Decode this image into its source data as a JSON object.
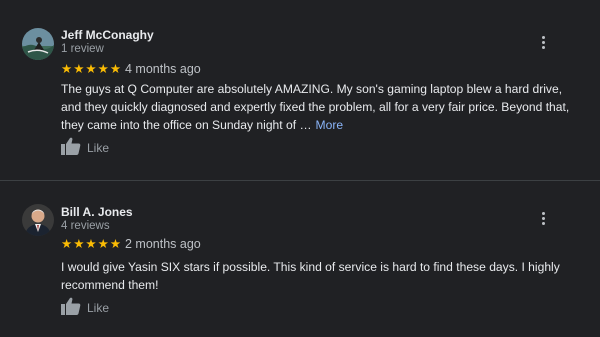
{
  "reviews": [
    {
      "reviewer_name": "Jeff McConaghy",
      "review_count": "1 review",
      "stars": "★★★★★",
      "rating": 5,
      "date": "4 months ago",
      "text": "The guys at Q Computer are absolutely AMAZING. My son's gaming laptop blew a hard drive, and they quickly diagnosed and expertly fixed the problem, all for a very fair price. Beyond that, they came into the office on Sunday night of …",
      "more_label": "More",
      "like_label": "Like"
    },
    {
      "reviewer_name": "Bill A. Jones",
      "review_count": "4 reviews",
      "stars": "★★★★★",
      "rating": 5,
      "date": "2 months ago",
      "text": "I would give Yasin SIX stars if possible. This kind of service is hard to find these days. I highly recommend them!",
      "like_label": "Like"
    }
  ],
  "colors": {
    "background": "#202124",
    "star": "#fbbc04",
    "link": "#8ab4f8",
    "secondary_text": "#9aa0a6"
  },
  "icons": [
    "avatar-photo",
    "thumbs-up-icon",
    "more-vert-icon"
  ]
}
